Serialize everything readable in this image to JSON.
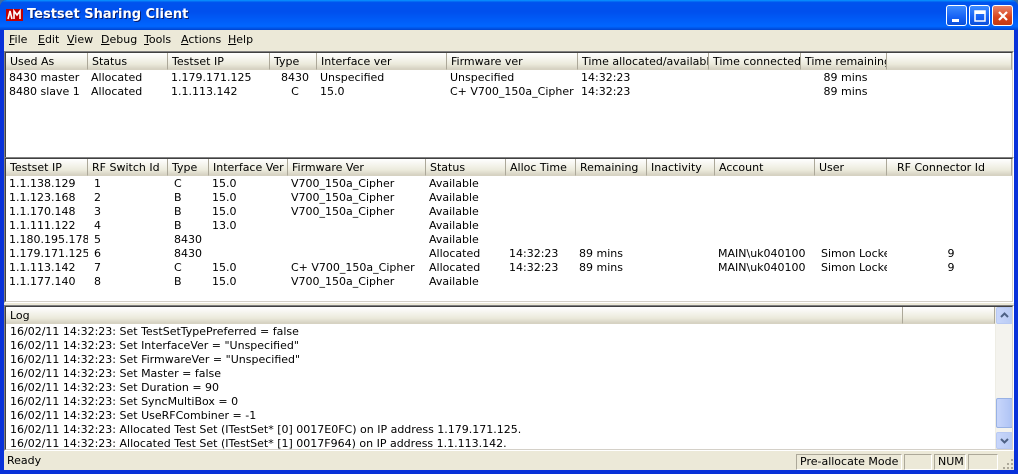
{
  "window": {
    "title": "Testset Sharing Client"
  },
  "menu": [
    {
      "label": "File",
      "u": "F",
      "rest": "ile"
    },
    {
      "label": "Edit",
      "u": "E",
      "rest": "dit"
    },
    {
      "label": "View",
      "u": "V",
      "rest": "iew"
    },
    {
      "label": "Debug",
      "u": "D",
      "rest": "ebug"
    },
    {
      "label": "Tools",
      "u": "T",
      "rest": "ools"
    },
    {
      "label": "Actions",
      "u": "A",
      "rest": "ctions"
    },
    {
      "label": "Help",
      "u": "H",
      "rest": "elp"
    }
  ],
  "top_table": {
    "headers": [
      "Used As",
      "Status",
      "Testset IP",
      "Type",
      "Interface ver",
      "Firmware ver",
      "Time allocated/available",
      "Time connected",
      "Time remaining"
    ],
    "rows": [
      [
        "8430 master",
        "Allocated",
        "1.179.171.125",
        "8430",
        "Unspecified",
        "Unspecified",
        "14:32:23",
        "",
        "89 mins"
      ],
      [
        "8480 slave 1",
        "Allocated",
        "1.1.113.142",
        "C",
        "15.0",
        "C+ V700_150a_Cipher",
        "14:32:23",
        "",
        "89 mins"
      ]
    ]
  },
  "mid_table": {
    "headers": [
      "Testset IP",
      "RF Switch Id",
      "Type",
      "Interface Ver",
      "Firmware Ver",
      "Status",
      "Alloc Time",
      "Remaining",
      "Inactivity",
      "Account",
      "User",
      "RF Connector Id"
    ],
    "rows": [
      [
        "1.1.138.129",
        "1",
        "C",
        "15.0",
        "V700_150a_Cipher",
        "Available",
        "",
        "",
        "",
        "",
        "",
        ""
      ],
      [
        "1.1.123.168",
        "2",
        "B",
        "15.0",
        "V700_150a_Cipher",
        "Available",
        "",
        "",
        "",
        "",
        "",
        ""
      ],
      [
        "1.1.170.148",
        "3",
        "B",
        "15.0",
        "V700_150a_Cipher",
        "Available",
        "",
        "",
        "",
        "",
        "",
        ""
      ],
      [
        "1.1.111.122",
        "4",
        "B",
        "13.0",
        "",
        "Available",
        "",
        "",
        "",
        "",
        "",
        ""
      ],
      [
        "1.180.195.178",
        "5",
        "8430",
        "",
        "",
        "Available",
        "",
        "",
        "",
        "",
        "",
        ""
      ],
      [
        "1.179.171.125",
        "6",
        "8430",
        "",
        "",
        "Allocated",
        "14:32:23",
        "89 mins",
        "",
        "MAIN\\uk040100",
        "Simon Locke",
        "9"
      ],
      [
        "1.1.113.142",
        "7",
        "C",
        "15.0",
        "C+ V700_150a_Cipher",
        "Allocated",
        "14:32:23",
        "89 mins",
        "",
        "MAIN\\uk040100",
        "Simon Locke",
        "9"
      ],
      [
        "1.1.177.140",
        "8",
        "B",
        "15.0",
        "V700_150a_Cipher",
        "Available",
        "",
        "",
        "",
        "",
        "",
        ""
      ]
    ]
  },
  "log": {
    "header": "Log",
    "lines": [
      "16/02/11 14:32:23: Set TestSetTypePreferred = false",
      "16/02/11 14:32:23: Set InterfaceVer = \"Unspecified\"",
      "16/02/11 14:32:23: Set FirmwareVer = \"Unspecified\"",
      "16/02/11 14:32:23: Set Master = false",
      "16/02/11 14:32:23: Set Duration = 90",
      "16/02/11 14:32:23: Set SyncMultiBox = 0",
      "16/02/11 14:32:23: Set UseRFCombiner = -1",
      "16/02/11 14:32:23: Allocated Test Set (ITestSet* [0] 0017E0FC) on IP address 1.179.171.125.",
      "16/02/11 14:32:23: Allocated Test Set (ITestSet* [1] 0017F964) on IP address 1.1.113.142."
    ],
    "scroll_position": 0.95
  },
  "status": {
    "ready": "Ready",
    "mode": "Pre-allocate Mode",
    "num": "NUM"
  },
  "colors": {
    "titlebar": "#0054e3",
    "face": "#ece9d8",
    "close": "#d8421b"
  }
}
